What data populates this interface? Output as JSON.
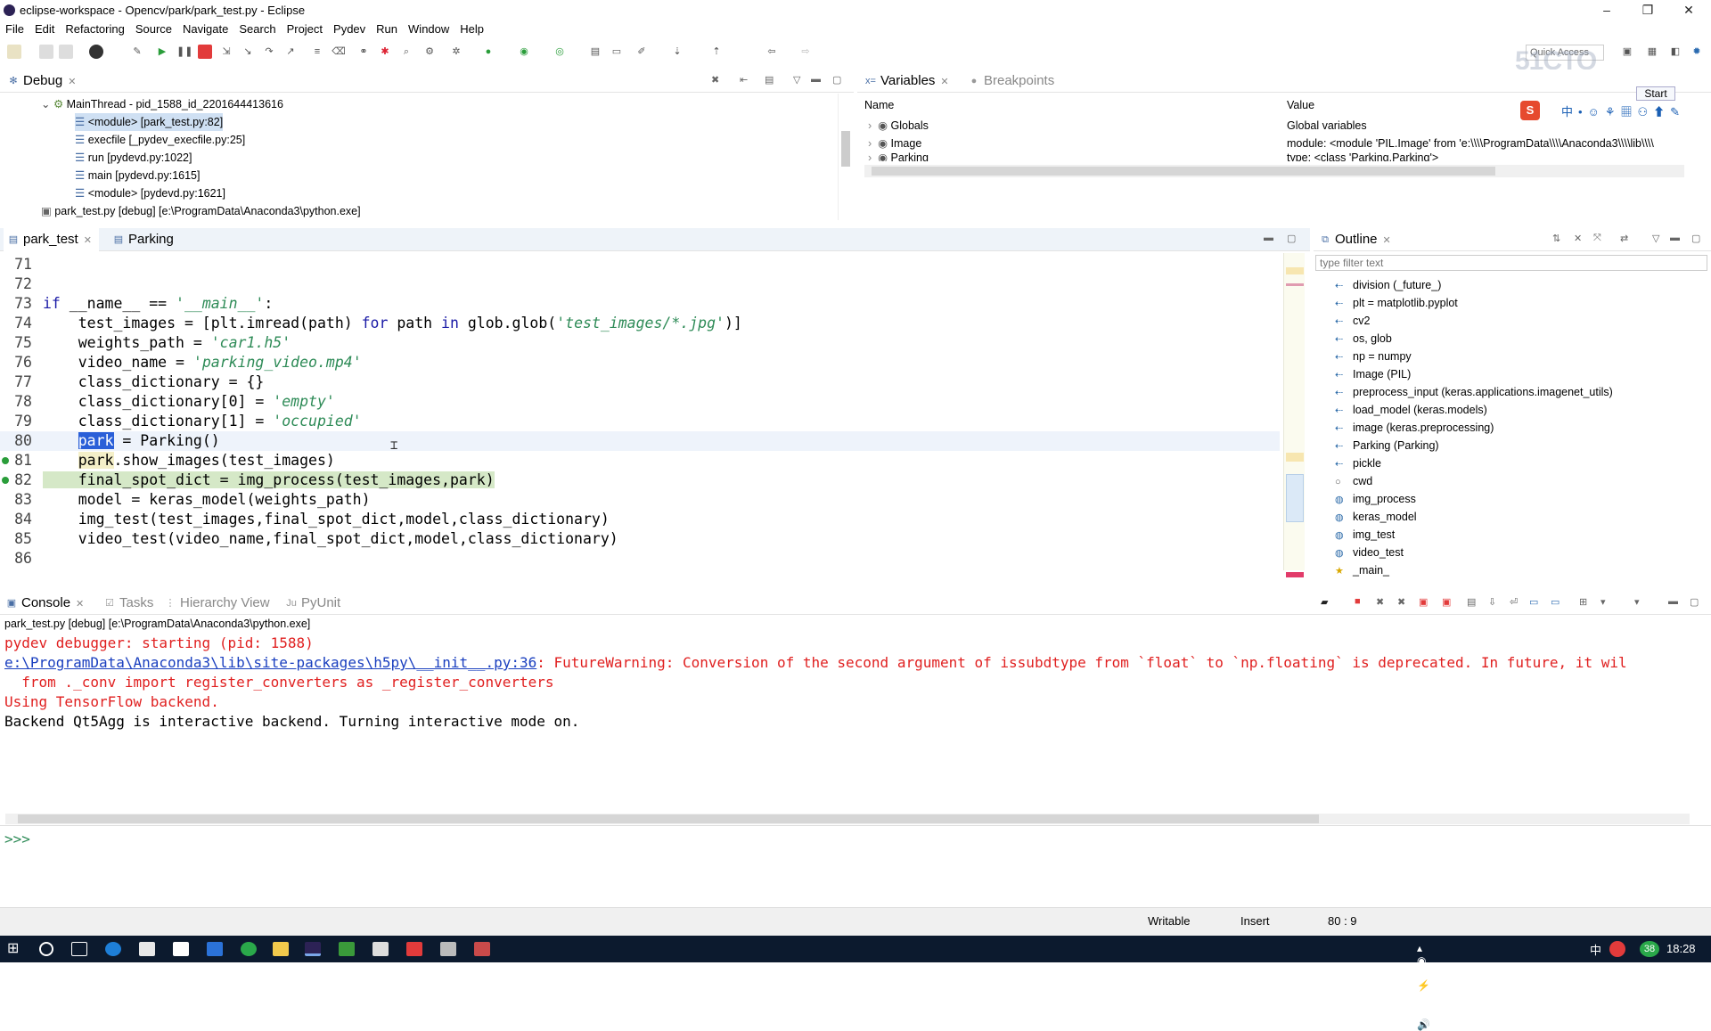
{
  "window": {
    "title": "eclipse-workspace - Opencv/park/park_test.py - Eclipse",
    "minimize": "–",
    "maximize": "❐",
    "close": "✕"
  },
  "menu": [
    "File",
    "Edit",
    "Refactoring",
    "Source",
    "Navigate",
    "Search",
    "Project",
    "Pydev",
    "Run",
    "Window",
    "Help"
  ],
  "quick_access": "Quick Access",
  "watermark": "51CTO学院",
  "ime_start": "Start",
  "debug": {
    "tab": "Debug",
    "thread": "MainThread - pid_1588_id_2201644413616",
    "frames": [
      "<module> [park_test.py:82]",
      "execfile [_pydev_execfile.py:25]",
      "run [pydevd.py:1022]",
      "main [pydevd.py:1615]",
      "<module> [pydevd.py:1621]"
    ],
    "process": "park_test.py [debug] [e:\\ProgramData\\Anaconda3\\python.exe]"
  },
  "variables": {
    "tab": "Variables",
    "tab2": "Breakpoints",
    "col_name": "Name",
    "col_value": "Value",
    "rows": [
      {
        "name": "Globals",
        "value": "Global variables"
      },
      {
        "name": "Image",
        "value": "module: <module 'PIL.Image' from 'e:\\\\\\\\ProgramData\\\\\\\\Anaconda3\\\\\\\\lib\\\\\\\\"
      },
      {
        "name": "Parking",
        "value": "type: <class 'Parking.Parking'>"
      }
    ]
  },
  "editor": {
    "tabs": [
      "park_test",
      "Parking"
    ],
    "lines": [
      {
        "n": "71",
        "tokens": []
      },
      {
        "n": "72",
        "tokens": []
      },
      {
        "n": "73",
        "tokens": [
          {
            "t": "if",
            "c": "kw"
          },
          {
            "t": " __name__ == ",
            "c": ""
          },
          {
            "t": "'__main__'",
            "c": "str"
          },
          {
            "t": ":",
            "c": ""
          }
        ]
      },
      {
        "n": "74",
        "tokens": [
          {
            "t": "    test_images = [plt.imread(path) ",
            "c": ""
          },
          {
            "t": "for",
            "c": "kw"
          },
          {
            "t": " path ",
            "c": ""
          },
          {
            "t": "in",
            "c": "kw"
          },
          {
            "t": " glob.glob(",
            "c": ""
          },
          {
            "t": "'test_images/*.jpg'",
            "c": "str"
          },
          {
            "t": ")]",
            "c": ""
          }
        ]
      },
      {
        "n": "75",
        "tokens": [
          {
            "t": "    weights_path = ",
            "c": ""
          },
          {
            "t": "'car1.h5'",
            "c": "str"
          }
        ]
      },
      {
        "n": "76",
        "tokens": [
          {
            "t": "    video_name = ",
            "c": ""
          },
          {
            "t": "'parking_video.mp4'",
            "c": "str"
          }
        ]
      },
      {
        "n": "77",
        "tokens": [
          {
            "t": "    class_dictionary = {}",
            "c": ""
          }
        ]
      },
      {
        "n": "78",
        "tokens": [
          {
            "t": "    class_dictionary[0] = ",
            "c": ""
          },
          {
            "t": "'empty'",
            "c": "str"
          }
        ]
      },
      {
        "n": "79",
        "tokens": [
          {
            "t": "    class_dictionary[1] = ",
            "c": ""
          },
          {
            "t": "'occupied'",
            "c": "str"
          }
        ]
      },
      {
        "n": "80",
        "tokens": [
          {
            "t": "    ",
            "c": ""
          },
          {
            "t": "park",
            "c": "sel"
          },
          {
            "t": " = Parking()",
            "c": ""
          }
        ]
      },
      {
        "n": "81",
        "tokens": [
          {
            "t": "    ",
            "c": ""
          },
          {
            "t": "park",
            "c": "occ"
          },
          {
            "t": ".show_images(test_images)",
            "c": ""
          }
        ]
      },
      {
        "n": "82",
        "tokens": [
          {
            "t": "    final_spot_dict = img_process(test_images,park)",
            "c": "cur"
          }
        ]
      },
      {
        "n": "83",
        "tokens": [
          {
            "t": "    model = keras_model(weights_path)",
            "c": ""
          }
        ]
      },
      {
        "n": "84",
        "tokens": [
          {
            "t": "    img_test(test_images,final_spot_dict,model,class_dictionary)",
            "c": ""
          }
        ]
      },
      {
        "n": "85",
        "tokens": [
          {
            "t": "    video_test(video_name,final_spot_dict,model,class_dictionary)",
            "c": ""
          }
        ]
      },
      {
        "n": "86",
        "tokens": []
      }
    ]
  },
  "outline": {
    "tab": "Outline",
    "filter_placeholder": "type filter text",
    "items": [
      {
        "label": "division (_future_)",
        "icon": "import"
      },
      {
        "label": "plt = matplotlib.pyplot",
        "icon": "import"
      },
      {
        "label": "cv2",
        "icon": "import"
      },
      {
        "label": "os, glob",
        "icon": "import"
      },
      {
        "label": "np = numpy",
        "icon": "import"
      },
      {
        "label": "Image (PIL)",
        "icon": "import"
      },
      {
        "label": "preprocess_input (keras.applications.imagenet_utils)",
        "icon": "import"
      },
      {
        "label": "load_model (keras.models)",
        "icon": "import"
      },
      {
        "label": "image (keras.preprocessing)",
        "icon": "import"
      },
      {
        "label": "Parking (Parking)",
        "icon": "import"
      },
      {
        "label": "pickle",
        "icon": "import"
      },
      {
        "label": "cwd",
        "icon": "var"
      },
      {
        "label": "img_process",
        "icon": "func"
      },
      {
        "label": "keras_model",
        "icon": "func"
      },
      {
        "label": "img_test",
        "icon": "func"
      },
      {
        "label": "video_test",
        "icon": "func"
      },
      {
        "label": "_main_",
        "icon": "star"
      }
    ]
  },
  "console": {
    "tabs": [
      "Console",
      "Tasks",
      "Hierarchy View",
      "PyUnit"
    ],
    "process": "park_test.py [debug] [e:\\ProgramData\\Anaconda3\\python.exe]",
    "line1": "pydev debugger: starting (pid: 1588)",
    "line2_link": "e:\\ProgramData\\Anaconda3\\lib\\site-packages\\h5py\\__init__.py:36",
    "line2_rest": ": FutureWarning: Conversion of the second argument of issubdtype from `float` to `np.floating` is deprecated. In future, it wil",
    "line3": "  from ._conv import register_converters as _register_converters",
    "line4": "Using TensorFlow backend.",
    "line5": "Backend Qt5Agg is interactive backend. Turning interactive mode on.",
    "prompt": ">>>"
  },
  "statusbar": {
    "writable": "Writable",
    "insert": "Insert",
    "position": "80 : 9"
  },
  "taskbar": {
    "clock": "18:28",
    "badge": "38",
    "ime": "中"
  }
}
